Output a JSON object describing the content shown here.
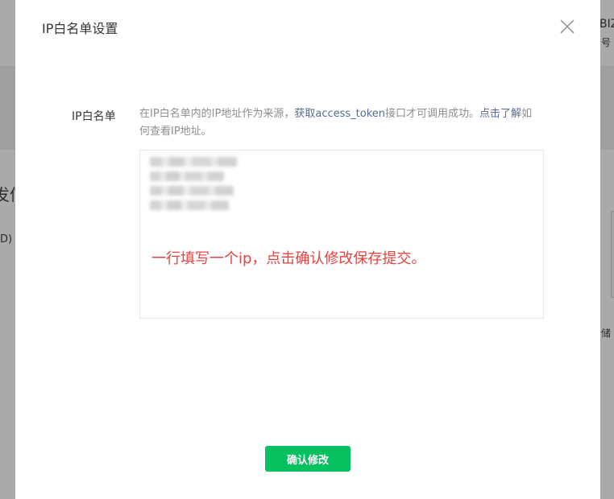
{
  "background": {
    "right_top_1": "BIZ",
    "right_top_2": "号",
    "left_mid_1": "发信",
    "left_mid_2": "D)",
    "right_mid": "储"
  },
  "modal": {
    "title": "IP白名单设置",
    "close_icon": "close-icon",
    "field_label": "IP白名单",
    "desc_part1": "在IP白名单内的IP地址作为来源，",
    "desc_link1": "获取access_token",
    "desc_part2": "接口才可调用成功。",
    "desc_link2": "点击了解",
    "desc_part3": "如何查看IP地址。",
    "hint": "一行填写一个ip，点击确认修改保存提交。",
    "confirm_label": "确认修改"
  },
  "colors": {
    "accent_green": "#07c160",
    "link_blue": "#576b95",
    "hint_red": "#e64340"
  }
}
